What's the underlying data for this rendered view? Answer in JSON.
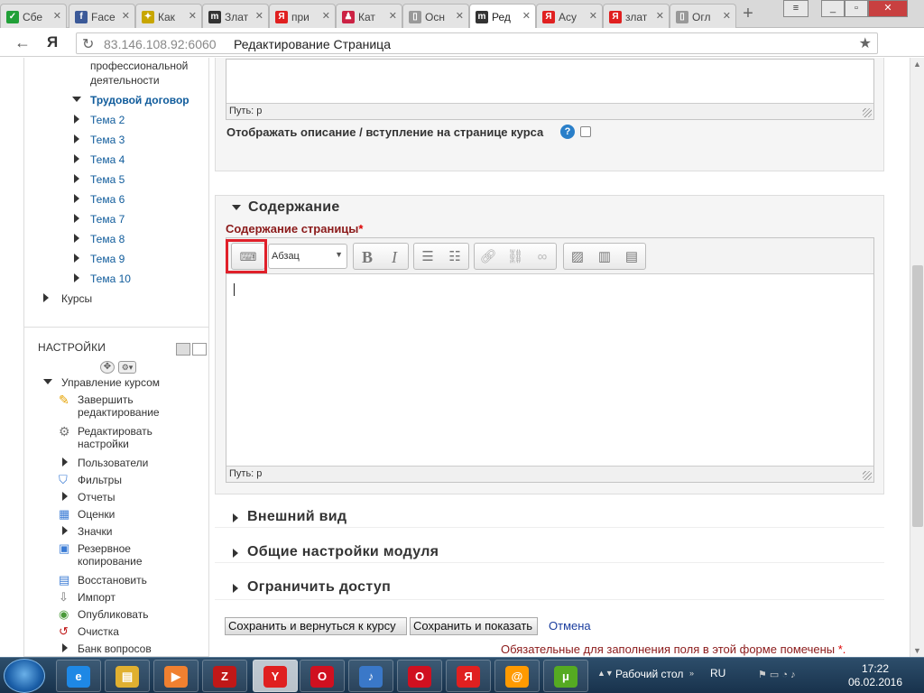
{
  "browser": {
    "tabs": [
      {
        "label": "Сбе",
        "icon_color": "#21a038",
        "icon_text": "✓"
      },
      {
        "label": "Face",
        "icon_color": "#3b5998",
        "icon_text": "f"
      },
      {
        "label": "Как",
        "icon_color": "#c8a600",
        "icon_text": "✦"
      },
      {
        "label": "Злат",
        "icon_color": "#333333",
        "icon_text": "m"
      },
      {
        "label": "при",
        "icon_color": "#e02020",
        "icon_text": "Я"
      },
      {
        "label": "Кат",
        "icon_color": "#cc2244",
        "icon_text": "♟"
      },
      {
        "label": "Осн",
        "icon_color": "#999999",
        "icon_text": "▯"
      },
      {
        "label": "Ред",
        "icon_color": "#333333",
        "icon_text": "m"
      },
      {
        "label": "Асу",
        "icon_color": "#e02020",
        "icon_text": "Я"
      },
      {
        "label": "злат",
        "icon_color": "#e02020",
        "icon_text": "Я"
      },
      {
        "label": "Огл",
        "icon_color": "#999999",
        "icon_text": "▯"
      }
    ],
    "url_host": "83.146.108.92:6060",
    "url_title": "Редактирование Страница",
    "yandex_logo": "Я"
  },
  "sidebar": {
    "tree": [
      {
        "label": "профессиональной"
      },
      {
        "label": "деятельности"
      },
      {
        "label": "Трудовой договор"
      },
      {
        "label": "Тема 2"
      },
      {
        "label": "Тема 3"
      },
      {
        "label": "Тема 4"
      },
      {
        "label": "Тема 5"
      },
      {
        "label": "Тема 6"
      },
      {
        "label": "Тема 7"
      },
      {
        "label": "Тема 8"
      },
      {
        "label": "Тема 9"
      },
      {
        "label": "Тема 10"
      },
      {
        "label": "Курсы"
      }
    ],
    "settings_header": "НАСТРОЙКИ",
    "course_admin": "Управление курсом",
    "admin_items": [
      {
        "label1": "Завершить",
        "label2": "редактирование",
        "icon": "pencil-icon"
      },
      {
        "label1": "Редактировать",
        "label2": "настройки",
        "icon": "gear-icon"
      },
      {
        "label1": "Пользователи",
        "label2": "",
        "icon": "triangle-icon"
      },
      {
        "label1": "Фильтры",
        "label2": "",
        "icon": "filter-icon"
      },
      {
        "label1": "Отчеты",
        "label2": "",
        "icon": "triangle-icon"
      },
      {
        "label1": "Оценки",
        "label2": "",
        "icon": "grades-icon"
      },
      {
        "label1": "Значки",
        "label2": "",
        "icon": "triangle-icon"
      },
      {
        "label1": "Резервное",
        "label2": "копирование",
        "icon": "backup-icon"
      },
      {
        "label1": "Восстановить",
        "label2": "",
        "icon": "restore-icon"
      },
      {
        "label1": "Импорт",
        "label2": "",
        "icon": "import-icon"
      },
      {
        "label1": "Опубликовать",
        "label2": "",
        "icon": "publish-icon"
      },
      {
        "label1": "Очистка",
        "label2": "",
        "icon": "reset-icon"
      },
      {
        "label1": "Банк вопросов",
        "label2": "",
        "icon": "triangle-icon"
      }
    ]
  },
  "main": {
    "top_path": "Путь: p",
    "show_description": "Отображать описание / вступление на странице курса",
    "content_section": "Содержание",
    "content_label": "Содержание страницы",
    "required_mark": "*",
    "format_select": "Абзац",
    "editor_path": "Путь: p",
    "sections": [
      "Внешний вид",
      "Общие настройки модуля",
      "Ограничить доступ"
    ],
    "save_return": "Сохранить и вернуться к курсу",
    "save_show": "Сохранить и показать",
    "cancel": "Отмена",
    "required_note": "Обязательные для заполнения поля в этой форме помечены",
    "required_note_mark": "*."
  },
  "taskbar": {
    "desktop_label": "Рабочий стол",
    "lang": "RU",
    "time": "17:22",
    "date": "06.02.2016",
    "apps": [
      {
        "name": "ie",
        "text": "e",
        "color": "#1e88e5"
      },
      {
        "name": "explorer",
        "text": "▤",
        "color": "#e0b030"
      },
      {
        "name": "media",
        "text": "▶",
        "color": "#f08030"
      },
      {
        "name": "zynga",
        "text": "Z",
        "color": "#c01818"
      },
      {
        "name": "yandex",
        "text": "Y",
        "color": "#e02020"
      },
      {
        "name": "opera",
        "text": "O",
        "color": "#d01020"
      },
      {
        "name": "sound",
        "text": "♪",
        "color": "#3a78c8"
      },
      {
        "name": "opera2",
        "text": "O",
        "color": "#d01020"
      },
      {
        "name": "yandex2",
        "text": "Я",
        "color": "#e02020"
      },
      {
        "name": "mail",
        "text": "@",
        "color": "#ff9a00"
      },
      {
        "name": "utorrent",
        "text": "μ",
        "color": "#55aa22"
      }
    ]
  }
}
